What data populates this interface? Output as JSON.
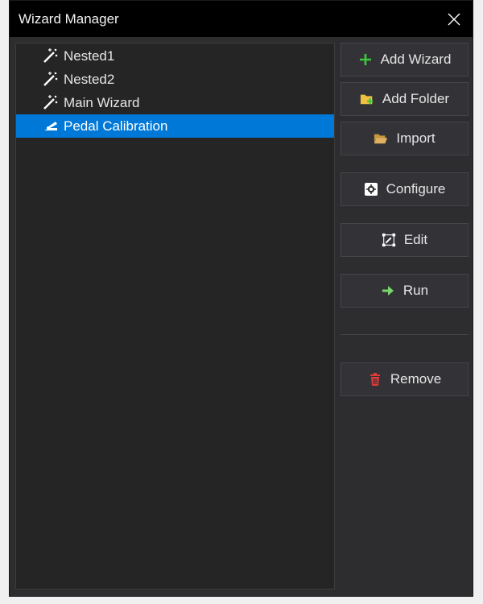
{
  "window": {
    "title": "Wizard Manager"
  },
  "tree": {
    "items": [
      {
        "label": "Nested1",
        "icon": "magic-wand-icon",
        "selected": false
      },
      {
        "label": "Nested2",
        "icon": "magic-wand-icon",
        "selected": false
      },
      {
        "label": "Main Wizard",
        "icon": "magic-wand-icon",
        "selected": false
      },
      {
        "label": "Pedal Calibration",
        "icon": "pedal-icon",
        "selected": true
      }
    ]
  },
  "buttons": {
    "add_wizard": "Add Wizard",
    "add_folder": "Add Folder",
    "import": "Import",
    "configure": "Configure",
    "edit": "Edit",
    "run": "Run",
    "remove": "Remove"
  },
  "colors": {
    "selection": "#0078d7",
    "add": "#3cc83c",
    "folder": "#f0c040",
    "run": "#7ad66b",
    "remove": "#e03a3a"
  }
}
